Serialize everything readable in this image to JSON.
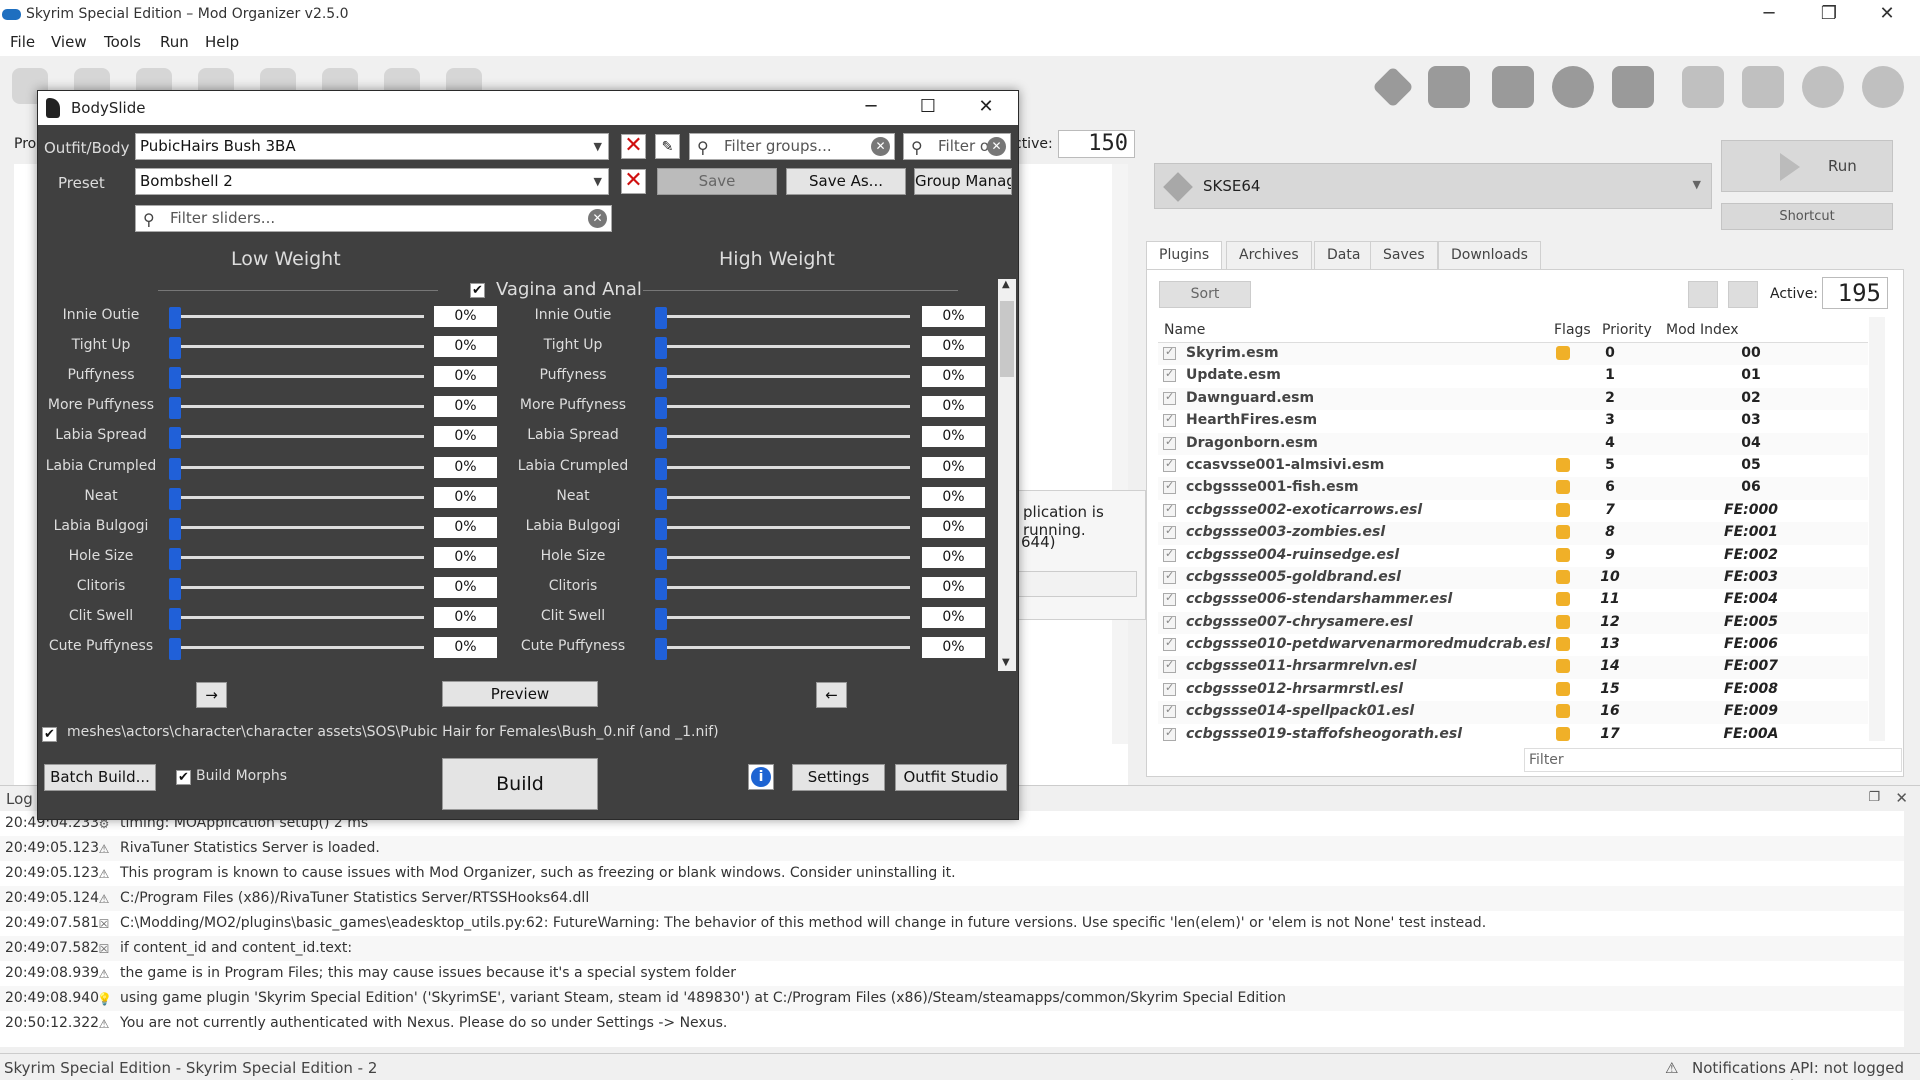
{
  "mo": {
    "title": "Skyrim Special Edition – Mod Organizer v2.5.0",
    "menu": [
      "File",
      "View",
      "Tools",
      "Run",
      "Help"
    ],
    "active_top_label": "ctive:",
    "active_top_value": "150",
    "executable": "SKSE64",
    "run_label": "Run",
    "shortcut_label": "Shortcut",
    "tabs": [
      "Plugins",
      "Archives",
      "Data",
      "Saves",
      "Downloads"
    ],
    "sort_label": "Sort",
    "active_label": "Active:",
    "active_count": "195",
    "columns": {
      "name": "Name",
      "flags": "Flags",
      "priority": "Priority",
      "mod_index": "Mod Index"
    },
    "plugins": [
      {
        "name": "Skyrim.esm",
        "flag": true,
        "priority": "0",
        "index": "00",
        "light": false
      },
      {
        "name": "Update.esm",
        "flag": false,
        "priority": "1",
        "index": "01",
        "light": false
      },
      {
        "name": "Dawnguard.esm",
        "flag": false,
        "priority": "2",
        "index": "02",
        "light": false
      },
      {
        "name": "HearthFires.esm",
        "flag": false,
        "priority": "3",
        "index": "03",
        "light": false
      },
      {
        "name": "Dragonborn.esm",
        "flag": false,
        "priority": "4",
        "index": "04",
        "light": false
      },
      {
        "name": "ccasvsse001-almsivi.esm",
        "flag": true,
        "priority": "5",
        "index": "05",
        "light": false
      },
      {
        "name": "ccbgssse001-fish.esm",
        "flag": true,
        "priority": "6",
        "index": "06",
        "light": false
      },
      {
        "name": "ccbgssse002-exoticarrows.esl",
        "flag": true,
        "priority": "7",
        "index": "FE:000",
        "light": true
      },
      {
        "name": "ccbgssse003-zombies.esl",
        "flag": true,
        "priority": "8",
        "index": "FE:001",
        "light": true
      },
      {
        "name": "ccbgssse004-ruinsedge.esl",
        "flag": true,
        "priority": "9",
        "index": "FE:002",
        "light": true
      },
      {
        "name": "ccbgssse005-goldbrand.esl",
        "flag": true,
        "priority": "10",
        "index": "FE:003",
        "light": true
      },
      {
        "name": "ccbgssse006-stendarshammer.esl",
        "flag": true,
        "priority": "11",
        "index": "FE:004",
        "light": true
      },
      {
        "name": "ccbgssse007-chrysamere.esl",
        "flag": true,
        "priority": "12",
        "index": "FE:005",
        "light": true
      },
      {
        "name": "ccbgssse010-petdwarvenarmoredmudcrab.esl",
        "flag": true,
        "priority": "13",
        "index": "FE:006",
        "light": true
      },
      {
        "name": "ccbgssse011-hrsarmrelvn.esl",
        "flag": true,
        "priority": "14",
        "index": "FE:007",
        "light": true
      },
      {
        "name": "ccbgssse012-hrsarmrstl.esl",
        "flag": true,
        "priority": "15",
        "index": "FE:008",
        "light": true
      },
      {
        "name": "ccbgssse014-spellpack01.esl",
        "flag": true,
        "priority": "16",
        "index": "FE:009",
        "light": true
      },
      {
        "name": "ccbgssse019-staffofsheogorath.esl",
        "flag": true,
        "priority": "17",
        "index": "FE:00A",
        "light": true
      }
    ],
    "filter_placeholder": "Filter",
    "bg_dialog_line1": "plication is running.",
    "bg_dialog_line2": "644)",
    "left_label": "Pro",
    "log_title": "Log",
    "log": [
      {
        "ts": "20:49:04.233",
        "icon": "gear",
        "msg": "timing: MOApplication setup() 2 ms"
      },
      {
        "ts": "20:49:05.123",
        "icon": "warning",
        "msg": "RivaTuner Statistics Server is loaded."
      },
      {
        "ts": "20:49:05.123",
        "icon": "warning",
        "msg": "This program is known to cause issues with Mod Organizer, such as freezing or blank windows. Consider uninstalling it."
      },
      {
        "ts": "20:49:05.124",
        "icon": "warning",
        "msg": "C:/Program Files (x86)/RivaTuner Statistics Server/RTSSHooks64.dll"
      },
      {
        "ts": "20:49:07.581",
        "icon": "error",
        "msg": "C:\\Modding/MO2/plugins\\basic_games\\eadesktop_utils.py:62: FutureWarning: The behavior of this method will change in future versions.  Use specific 'len(elem)' or 'elem is not None' test instead."
      },
      {
        "ts": "20:49:07.582",
        "icon": "error",
        "msg": " if content_id and content_id.text:"
      },
      {
        "ts": "20:49:08.939",
        "icon": "warning",
        "msg": "the game is in Program Files; this may cause issues because it's a special system folder"
      },
      {
        "ts": "20:49:08.940",
        "icon": "info",
        "msg": "using game plugin 'Skyrim Special Edition' ('SkyrimSE', variant Steam, steam id '489830') at C:/Program Files (x86)/Steam/steamapps/common/Skyrim Special Edition"
      },
      {
        "ts": "20:50:12.322",
        "icon": "warning",
        "msg": "You are not currently authenticated with Nexus. Please do so under Settings -> Nexus."
      }
    ],
    "status_left": "Skyrim Special Edition - Skyrim Special Edition - 2",
    "status_notifications": "Notifications",
    "status_api": "API: not logged in"
  },
  "bodyslide": {
    "title": "BodySlide",
    "outfit_label": "Outfit/Body",
    "outfit_value": "PubicHairs Bush 3BA",
    "preset_label": "Preset",
    "preset_value": "Bombshell 2",
    "filter_groups_placeholder": "Filter groups...",
    "filter_outfits_placeholder": "Filter o",
    "filter_sliders_placeholder": "Filter sliders...",
    "save_label": "Save",
    "save_as_label": "Save As...",
    "group_manager_label": "Group Manager",
    "low_weight": "Low Weight",
    "high_weight": "High Weight",
    "group_name": "Vagina and Anal",
    "sliders": [
      {
        "name": "Innie Outie",
        "low": "0%",
        "high": "0%"
      },
      {
        "name": "Tight Up",
        "low": "0%",
        "high": "0%"
      },
      {
        "name": "Puffyness",
        "low": "0%",
        "high": "0%"
      },
      {
        "name": "More Puffyness",
        "low": "0%",
        "high": "0%"
      },
      {
        "name": "Labia Spread",
        "low": "0%",
        "high": "0%"
      },
      {
        "name": "Labia Crumpled",
        "low": "0%",
        "high": "0%"
      },
      {
        "name": "Neat",
        "low": "0%",
        "high": "0%"
      },
      {
        "name": "Labia Bulgogi",
        "low": "0%",
        "high": "0%"
      },
      {
        "name": "Hole Size",
        "low": "0%",
        "high": "0%"
      },
      {
        "name": "Clitoris",
        "low": "0%",
        "high": "0%"
      },
      {
        "name": "Clit Swell",
        "low": "0%",
        "high": "0%"
      },
      {
        "name": "Cute Puffyness",
        "low": "0%",
        "high": "0%"
      }
    ],
    "arrow_right": "→",
    "arrow_left": "←",
    "preview_label": "Preview",
    "output_path": "meshes\\actors\\character\\character assets\\SOS\\Pubic Hair for Females\\Bush_0.nif (and _1.nif)",
    "batch_build_label": "Batch Build...",
    "build_morphs_label": "Build Morphs",
    "build_label": "Build",
    "settings_label": "Settings",
    "outfit_studio_label": "Outfit Studio",
    "accent_color": "#2060d8"
  }
}
